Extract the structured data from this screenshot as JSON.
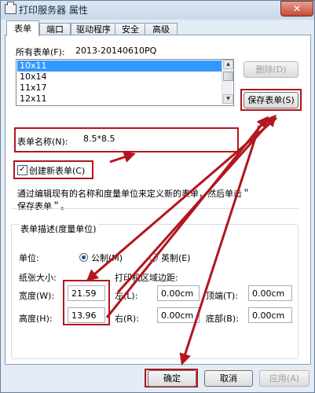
{
  "window": {
    "title": "打印服务器 属性",
    "close_glyph": "✕"
  },
  "tabs": [
    {
      "label": "表单",
      "active": true
    },
    {
      "label": "端口",
      "active": false
    },
    {
      "label": "驱动程序",
      "active": false
    },
    {
      "label": "安全",
      "active": false
    },
    {
      "label": "高级",
      "active": false
    }
  ],
  "forms": {
    "label": "所有表单(F):",
    "server_name": "2013-20140610PQ",
    "list": [
      "10x11",
      "10x14",
      "11x17",
      "12x11"
    ],
    "selected_index": 0,
    "delete_button": "删除(D)",
    "save_button": "保存表单(S)"
  },
  "form_name": {
    "label": "表单名称(N):",
    "value": "8.5*8.5"
  },
  "create_new": {
    "label": "创建新表单(C)",
    "checked": true
  },
  "hint": {
    "line1": "通过编辑现有的名称和度量单位来定义新的表单，然后单击＂",
    "line2": "保存表单＂。"
  },
  "description": {
    "group_label": "表单描述(度量单位)",
    "unit_label": "单位:",
    "unit_metric": "公制(M)",
    "unit_imperial": "英制(E)",
    "unit_selected": "metric",
    "paper_size_label": "纸张大小:",
    "margins_label": "打印机区域边距:",
    "width_label": "宽度(W):",
    "width_value": "21.59",
    "height_label": "高度(H):",
    "height_value": "13.96",
    "left_label": "左(L):",
    "left_value": "0.00cm",
    "right_label": "右(R):",
    "right_value": "0.00cm",
    "top_label": "顶端(T):",
    "top_value": "0.00cm",
    "bottom_label": "底部(B):",
    "bottom_value": "0.00cm"
  },
  "footer": {
    "ok": "确定",
    "cancel": "取消",
    "apply": "应用(A)"
  },
  "colors": {
    "annotation_red": "#b2161f",
    "selection_blue": "#3399ff"
  }
}
